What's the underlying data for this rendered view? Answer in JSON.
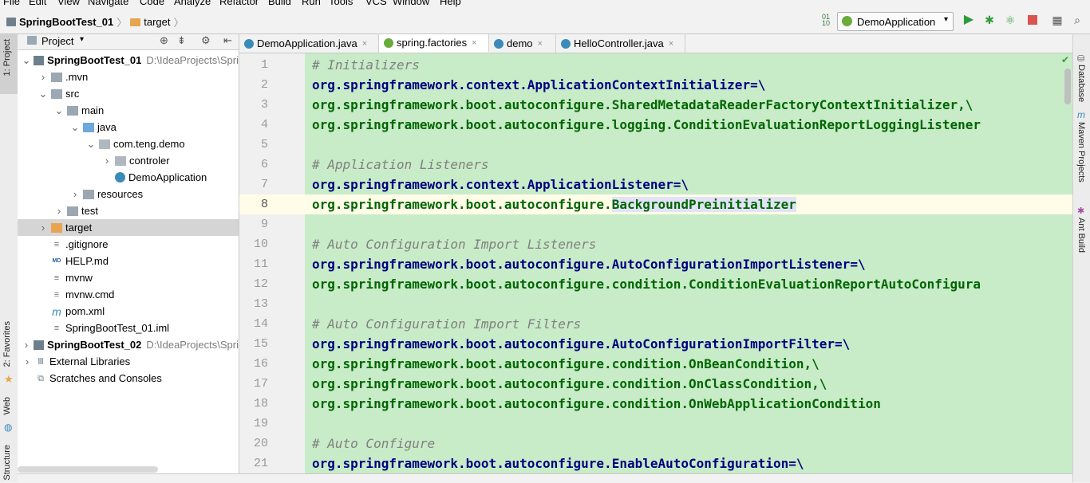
{
  "menu": [
    "File",
    "Edit",
    "View",
    "Navigate",
    "Code",
    "Analyze",
    "Refactor",
    "Build",
    "Run",
    "Tools",
    "VCS",
    "Window",
    "Help"
  ],
  "breadcrumb": {
    "project": "SpringBootTest_01",
    "folder": "target"
  },
  "toolbar": {
    "run_config": "DemoApplication"
  },
  "left_strip": {
    "project": "1: Project",
    "favorites": "2: Favorites",
    "web": "Web",
    "structure": "Structure"
  },
  "right_strip": {
    "database": "Database",
    "maven": "Maven Projects",
    "ant": "Ant Build"
  },
  "project_panel": {
    "title": "Project"
  },
  "tree": [
    {
      "label": "SpringBootTest_01",
      "path": "D:\\IdeaProjects\\Spri",
      "indent": 0,
      "arrow": "▼",
      "icon": "proj",
      "bold": true
    },
    {
      "label": ".mvn",
      "indent": 1,
      "arrow": "▶",
      "icon": "folder"
    },
    {
      "label": "src",
      "indent": 1,
      "arrow": "▼",
      "icon": "folder"
    },
    {
      "label": "main",
      "indent": 2,
      "arrow": "▼",
      "icon": "folder"
    },
    {
      "label": "java",
      "indent": 3,
      "arrow": "▼",
      "icon": "folder-blue"
    },
    {
      "label": "com.teng.demo",
      "indent": 4,
      "arrow": "▼",
      "icon": "package"
    },
    {
      "label": "controler",
      "indent": 5,
      "arrow": "▶",
      "icon": "package"
    },
    {
      "label": "DemoApplication",
      "indent": 5,
      "arrow": "",
      "icon": "class"
    },
    {
      "label": "resources",
      "indent": 3,
      "arrow": "▶",
      "icon": "folder-res"
    },
    {
      "label": "test",
      "indent": 2,
      "arrow": "▶",
      "icon": "folder"
    },
    {
      "label": "target",
      "indent": 1,
      "arrow": "▶",
      "icon": "folder-orange",
      "selected": true
    },
    {
      "label": ".gitignore",
      "indent": 1,
      "arrow": "",
      "icon": "file"
    },
    {
      "label": "HELP.md",
      "indent": 1,
      "arrow": "",
      "icon": "md"
    },
    {
      "label": "mvnw",
      "indent": 1,
      "arrow": "",
      "icon": "file"
    },
    {
      "label": "mvnw.cmd",
      "indent": 1,
      "arrow": "",
      "icon": "file"
    },
    {
      "label": "pom.xml",
      "indent": 1,
      "arrow": "",
      "icon": "maven"
    },
    {
      "label": "SpringBootTest_01.iml",
      "indent": 1,
      "arrow": "",
      "icon": "file"
    },
    {
      "label": "SpringBootTest_02",
      "path": "D:\\IdeaProjects\\Spri",
      "indent": 0,
      "arrow": "▶",
      "icon": "proj",
      "bold": true
    },
    {
      "label": "External Libraries",
      "indent": 0,
      "arrow": "▶",
      "icon": "lib"
    },
    {
      "label": "Scratches and Consoles",
      "indent": 0,
      "arrow": "",
      "icon": "scratch"
    }
  ],
  "tabs": [
    {
      "label": "DemoApplication.java",
      "icon": "c",
      "color": "#3b8bba"
    },
    {
      "label": "spring.factories",
      "icon": "s",
      "color": "#6aab3c",
      "active": true
    },
    {
      "label": "demo",
      "icon": "m",
      "color": "#3b8bba"
    },
    {
      "label": "HelloController.java",
      "icon": "c",
      "color": "#3b8bba"
    }
  ],
  "code": [
    {
      "n": "1",
      "t": "comment",
      "text": "# Initializers"
    },
    {
      "n": "2",
      "t": "key",
      "pkg": "org.springframework.context.",
      "cls": "ApplicationContextInitializer",
      "tail": "=\\"
    },
    {
      "n": "3",
      "t": "val",
      "pkg": "org.springframework.boot.autoconfigure.",
      "cls": "SharedMetadataReaderFactoryContextInitializer",
      "tail": ",\\"
    },
    {
      "n": "4",
      "t": "val",
      "pkg": "org.springframework.boot.autoconfigure.logging.",
      "cls": "ConditionEvaluationReportLoggingListener",
      "tail": ""
    },
    {
      "n": "5",
      "t": "blank",
      "text": ""
    },
    {
      "n": "6",
      "t": "comment",
      "text": "# Application Listeners"
    },
    {
      "n": "7",
      "t": "key",
      "pkg": "org.springframework.context.",
      "cls": "ApplicationListener",
      "tail": "=\\"
    },
    {
      "n": "8",
      "t": "val",
      "pkg": "org.springframework.boot.autoconfigure.",
      "cls": "BackgroundPreinitializer",
      "tail": "",
      "current": true
    },
    {
      "n": "9",
      "t": "blank",
      "text": ""
    },
    {
      "n": "10",
      "t": "comment",
      "text": "# Auto Configuration Import Listeners"
    },
    {
      "n": "11",
      "t": "key",
      "pkg": "org.springframework.boot.autoconfigure.",
      "cls": "AutoConfigurationImportListener",
      "tail": "=\\"
    },
    {
      "n": "12",
      "t": "val",
      "pkg": "org.springframework.boot.autoconfigure.condition.",
      "cls": "ConditionEvaluationReportAutoConfigura",
      "tail": ""
    },
    {
      "n": "13",
      "t": "blank",
      "text": ""
    },
    {
      "n": "14",
      "t": "comment",
      "text": "# Auto Configuration Import Filters"
    },
    {
      "n": "15",
      "t": "key",
      "pkg": "org.springframework.boot.autoconfigure.",
      "cls": "AutoConfigurationImportFilter",
      "tail": "=\\"
    },
    {
      "n": "16",
      "t": "val",
      "pkg": "org.springframework.boot.autoconfigure.condition.",
      "cls": "OnBeanCondition",
      "tail": ",\\"
    },
    {
      "n": "17",
      "t": "val",
      "pkg": "org.springframework.boot.autoconfigure.condition.",
      "cls": "OnClassCondition",
      "tail": ",\\"
    },
    {
      "n": "18",
      "t": "val",
      "pkg": "org.springframework.boot.autoconfigure.condition.",
      "cls": "OnWebApplicationCondition",
      "tail": ""
    },
    {
      "n": "19",
      "t": "blank",
      "text": ""
    },
    {
      "n": "20",
      "t": "comment",
      "text": "# Auto Configure"
    },
    {
      "n": "21",
      "t": "key",
      "pkg": "org.springframework.boot.autoconfigure.",
      "cls": "EnableAutoConfiguration",
      "tail": "=\\"
    }
  ],
  "colors": {
    "editor_bg": "#c8ebc8",
    "package": "#000080",
    "class": "#006600",
    "comment": "#808080",
    "selection": "#d5d5d5"
  }
}
